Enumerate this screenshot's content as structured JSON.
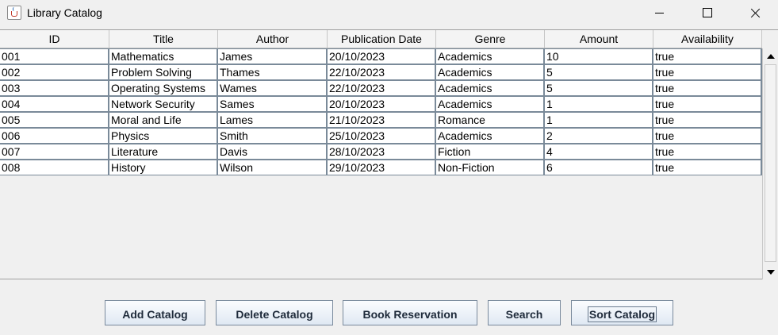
{
  "window": {
    "title": "Library Catalog"
  },
  "table": {
    "columns": [
      "ID",
      "Title",
      "Author",
      "Publication Date",
      "Genre",
      "Amount",
      "Availability"
    ],
    "rows": [
      [
        "001",
        "Mathematics",
        "James",
        "20/10/2023",
        "Academics",
        "10",
        "true"
      ],
      [
        "002",
        "Problem Solving",
        "Thames",
        "22/10/2023",
        "Academics",
        "5",
        "true"
      ],
      [
        "003",
        "Operating Systems",
        "Wames",
        "22/10/2023",
        "Academics",
        "5",
        "true"
      ],
      [
        "004",
        "Network Security",
        "Sames",
        "20/10/2023",
        "Academics",
        "1",
        "true"
      ],
      [
        "005",
        "Moral and Life",
        "Lames",
        "21/10/2023",
        "Romance",
        "1",
        "true"
      ],
      [
        "006",
        "Physics",
        "Smith",
        "25/10/2023",
        "Academics",
        "2",
        "true"
      ],
      [
        "007",
        "Literature",
        "Davis",
        "28/10/2023",
        "Fiction",
        "4",
        "true"
      ],
      [
        "008",
        "History",
        "Wilson",
        "29/10/2023",
        "Non-Fiction",
        "6",
        "true"
      ]
    ]
  },
  "buttons": {
    "add": "Add Catalog",
    "delete": "Delete Catalog",
    "reserve": "Book Reservation",
    "search": "Search",
    "sort": "Sort Catalog"
  },
  "icons": {
    "app": "java-cup-icon",
    "minimize": "minimize-icon",
    "maximize": "maximize-icon",
    "close": "close-icon",
    "scroll_up": "arrow-up-icon",
    "scroll_down": "arrow-down-icon"
  }
}
